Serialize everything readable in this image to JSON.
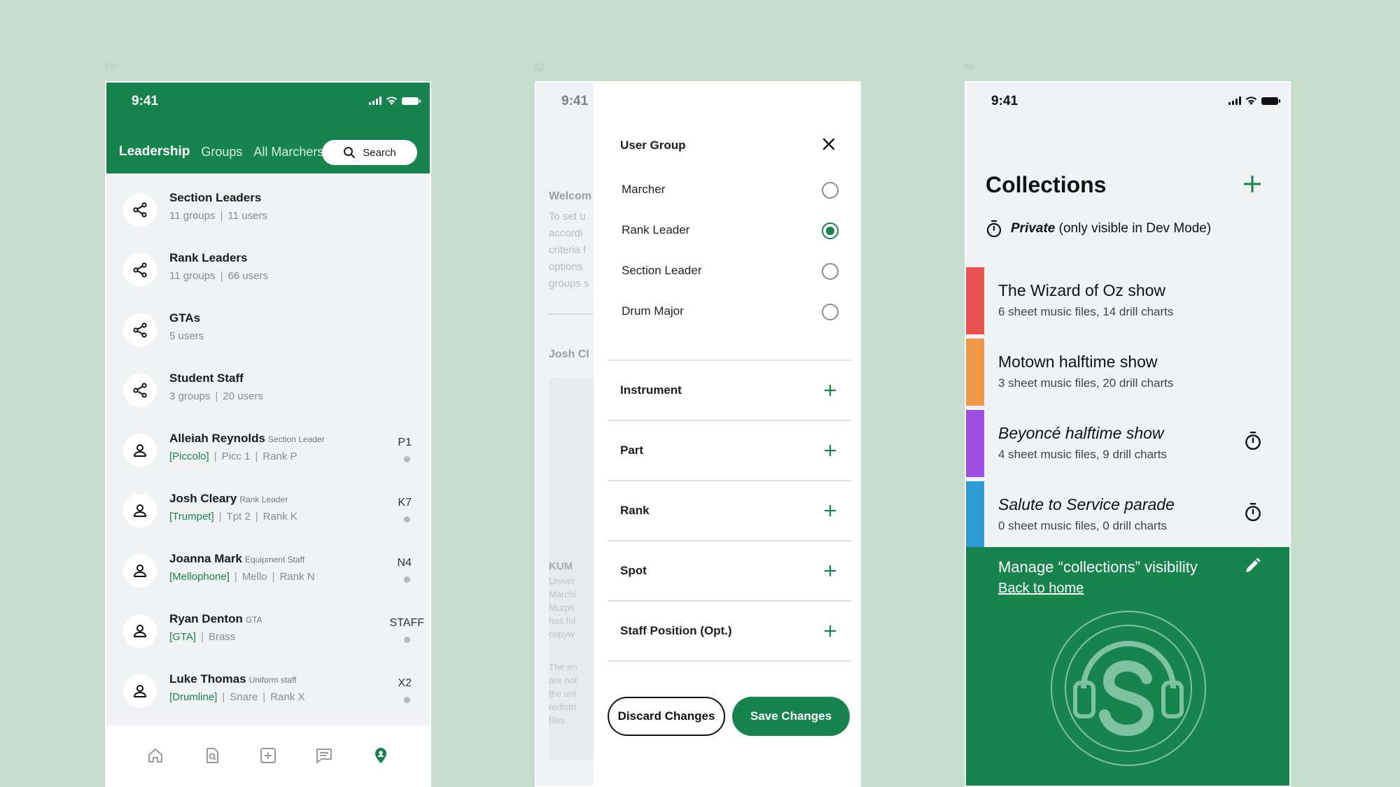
{
  "frames": {
    "f1": "50",
    "f2": "52",
    "f3": "60"
  },
  "phone1": {
    "time": "9:41",
    "tabs": [
      "Leadership",
      "Groups",
      "All Marchers"
    ],
    "search_label": "Search",
    "groups": [
      {
        "name": "Section Leaders",
        "sub": [
          "11 groups",
          "11 users"
        ]
      },
      {
        "name": "Rank Leaders",
        "sub": [
          "11 groups",
          "66 users"
        ]
      },
      {
        "name": "GTAs",
        "sub": [
          "5 users"
        ]
      },
      {
        "name": "Student Staff",
        "sub": [
          "3 groups",
          "20 users"
        ]
      }
    ],
    "users": [
      {
        "name": "Alleiah Reynolds",
        "role": "Section Leader",
        "instrument": "[Piccolo]",
        "sub": [
          "Picc 1",
          "Rank P"
        ],
        "spot": "P1"
      },
      {
        "name": "Josh Cleary",
        "role": "Rank Leader",
        "instrument": "[Trumpet]",
        "sub": [
          "Tpt 2",
          "Rank K"
        ],
        "spot": "K7"
      },
      {
        "name": "Joanna Mark",
        "role": "Equipment Staff",
        "instrument": "[Mellophone]",
        "sub": [
          "Mello",
          "Rank N"
        ],
        "spot": "N4"
      },
      {
        "name": "Ryan Denton",
        "role": "GTA",
        "instrument": "[GTA]",
        "sub": [
          "Brass"
        ],
        "spot": "STAFF"
      },
      {
        "name": "Luke Thomas",
        "role": "Uniform staff",
        "instrument": "[Drumline]",
        "sub": [
          "Snare",
          "Rank X"
        ],
        "spot": "X2"
      }
    ],
    "nav_icons": [
      "home-icon",
      "search-document-icon",
      "add-square-icon",
      "chat-icon",
      "location-person-icon"
    ]
  },
  "phone2": {
    "time": "9:41",
    "bg": {
      "welcome": "Welcom",
      "lines": [
        "To set u",
        "accordi",
        "criteria f",
        "options",
        "groups s"
      ],
      "person": "Josh Cl",
      "card_title": "KUM",
      "card_lines": [
        "Univer",
        "Marchi",
        "Murph",
        "has ful",
        "copyw"
      ],
      "card_lines2": [
        "The en",
        "are not",
        "the unl",
        "redistri",
        "files."
      ]
    },
    "modal": {
      "title": "User Group",
      "options": [
        {
          "label": "Marcher",
          "selected": false
        },
        {
          "label": "Rank Leader",
          "selected": true
        },
        {
          "label": "Section Leader",
          "selected": false
        },
        {
          "label": "Drum Major",
          "selected": false
        }
      ],
      "sections": [
        "Instrument",
        "Part",
        "Rank",
        "Spot",
        "Staff Position (Opt.)"
      ],
      "discard_label": "Discard Changes",
      "save_label": "Save Changes"
    }
  },
  "phone3": {
    "time": "9:41",
    "title": "Collections",
    "private_word": "Private",
    "private_note": "(only visible in Dev Mode)",
    "collections": [
      {
        "name": "The Wizard of Oz show",
        "stats": "6 sheet music files, 14 drill charts",
        "color": "#e8524f",
        "private": false
      },
      {
        "name": "Motown halftime show",
        "stats": "3 sheet music files, 20 drill charts",
        "color": "#f0974a",
        "private": false
      },
      {
        "name": "Beyoncé halftime show",
        "stats": "4 sheet music files, 9 drill charts",
        "color": "#9c4fe0",
        "private": true
      },
      {
        "name": "Salute to Service parade",
        "stats": "0 sheet music files, 0 drill charts",
        "color": "#2f9bd6",
        "private": true
      }
    ],
    "manage_title": "Manage “collections” visibility",
    "back_link": "Back to home"
  },
  "colors": {
    "brand_green": "#17844d",
    "background": "#c6ddcd"
  }
}
